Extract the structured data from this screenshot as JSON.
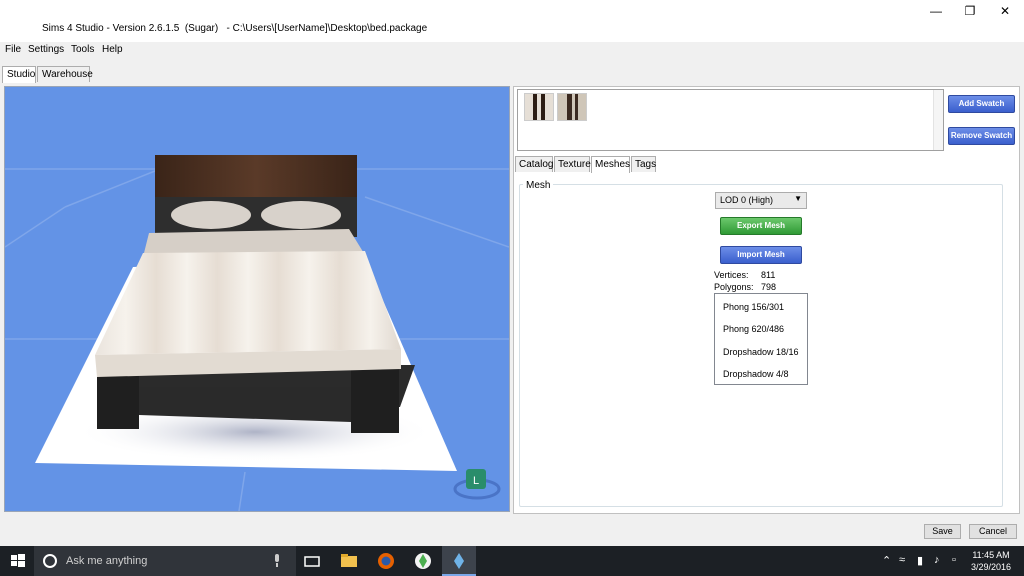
{
  "window": {
    "title": "Sims 4 Studio - Version 2.6.1.5  (Sugar)   - C:\\Users\\[UserName]\\Desktop\\bed.package",
    "minimize_glyph": "—",
    "maximize_glyph": "❐",
    "close_glyph": "✕"
  },
  "menu": {
    "items": [
      {
        "label": "File"
      },
      {
        "label": "Settings"
      },
      {
        "label": "Tools"
      },
      {
        "label": "Help"
      }
    ]
  },
  "main_tabs": [
    {
      "label": "Studio",
      "active": true
    },
    {
      "label": "Warehouse",
      "active": false
    }
  ],
  "swatches": {
    "add_label": "Add Swatch",
    "remove_label": "Remove Swatch",
    "items": [
      {
        "name": "swatch-dark-wood",
        "color_a": "#2c1d14",
        "color_b": "#e6dfd6"
      },
      {
        "name": "swatch-light-wood",
        "color_a": "#3b2a20",
        "color_b": "#cfc6b8"
      }
    ]
  },
  "sub_tabs": [
    {
      "label": "Catalog",
      "active": false
    },
    {
      "label": "Texture",
      "active": false
    },
    {
      "label": "Meshes",
      "active": true
    },
    {
      "label": "Tags",
      "active": false
    }
  ],
  "mesh": {
    "group_label": "Mesh",
    "lod_value": "LOD 0 (High)",
    "export_label": "Export Mesh",
    "import_label": "Import Mesh",
    "vertices_label": "Vertices:",
    "vertices_value": "811",
    "polygons_label": "Polygons:",
    "polygons_value": "798",
    "list": [
      {
        "label": "Phong 156/301"
      },
      {
        "label": "Phong 620/486"
      },
      {
        "label": "Dropshadow 18/16"
      },
      {
        "label": "Dropshadow 4/8"
      }
    ]
  },
  "viewport": {
    "lod_badge": "L"
  },
  "footer": {
    "save_label": "Save",
    "cancel_label": "Cancel"
  },
  "taskbar": {
    "search_placeholder": "Ask me anything",
    "time": "11:45 AM",
    "date": "3/29/2016"
  },
  "colors": {
    "viewport_bg": "#6393e6",
    "accent_blue": "#3a5fcd",
    "accent_green": "#2f9a35"
  }
}
